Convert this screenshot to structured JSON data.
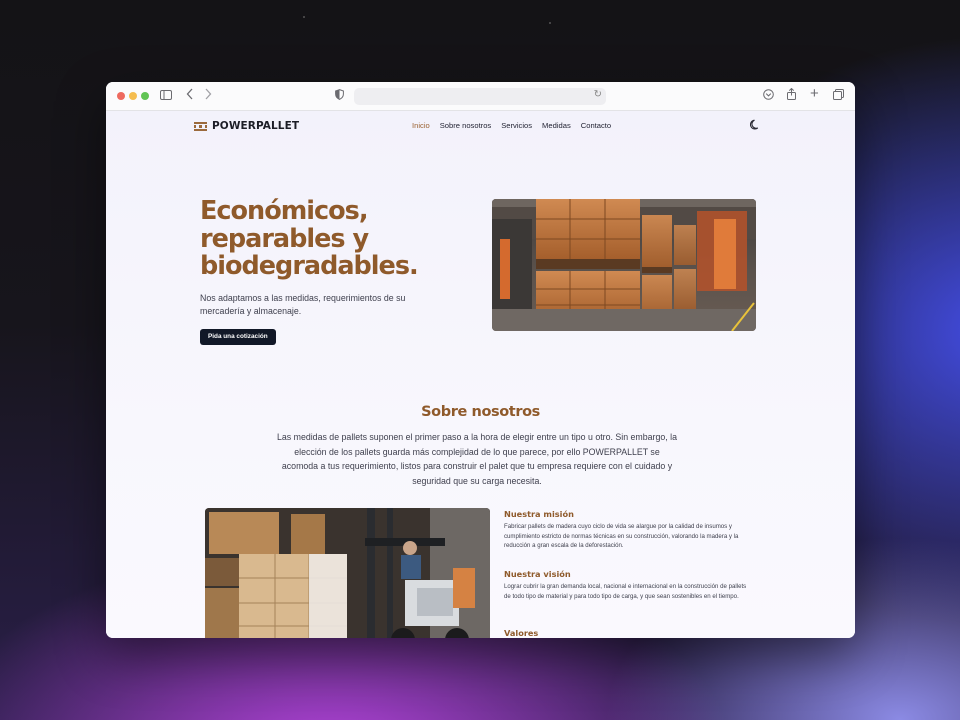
{
  "browser": {
    "traffic_lights": [
      "#ee6a5f",
      "#f5bd4f",
      "#61c454"
    ]
  },
  "site": {
    "brand": "POWERPALLET",
    "nav": [
      {
        "label": "Inicio",
        "active": true
      },
      {
        "label": "Sobre nosotros",
        "active": false
      },
      {
        "label": "Servicios",
        "active": false
      },
      {
        "label": "Medidas",
        "active": false
      },
      {
        "label": "Contacto",
        "active": false
      }
    ],
    "theme_toggle_icon": "moon-icon",
    "accent_color": "#8f5a2b"
  },
  "hero": {
    "title_line1": "Económicos,",
    "title_line2": "reparables y",
    "title_line3": "biodegradables.",
    "subtitle": "Nos adaptamos a las medidas, requerimientos de su mercadería y almacenaje.",
    "cta_label": "Pida una cotización"
  },
  "about": {
    "title": "Sobre nosotros",
    "text": "Las medidas de pallets suponen el primer paso a la hora de elegir entre un tipo u otro. Sin embargo, la elección de los pallets guarda más complejidad de lo que parece, por ello POWERPALLET se acomoda a tus requerimiento, listos para construir el palet que tu empresa requiere con el cuidado y seguridad que su carga necesita.",
    "mission_title": "Nuestra misión",
    "mission_text": "Fabricar pallets de madera cuyo ciclo de vida se alargue por la calidad de insumos y cumplimiento estricto de normas técnicas en su construcción, valorando la madera y la reducción a gran escala de la deforestación.",
    "vision_title": "Nuestra visión",
    "vision_text": "Lograr cubrir la gran demanda local, nacional e internacional en la construcción de pallets de todo tipo de material y para todo tipo de carga, y que sean sostenibles en el tiempo.",
    "values_title": "Valores"
  }
}
